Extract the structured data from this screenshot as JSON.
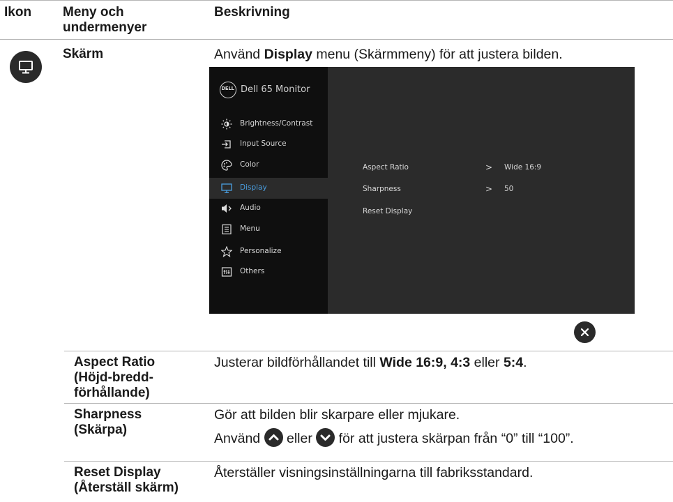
{
  "headers": {
    "icon": "Ikon",
    "menu": "Meny och undermenyer",
    "description": "Beskrivning"
  },
  "display_row": {
    "menu_name": "Skärm",
    "intro_prefix": "Använd ",
    "intro_bold": "Display",
    "intro_suffix": " menu (Skärmmeny) för att justera bilden."
  },
  "osd": {
    "logo_text": "DELL",
    "title": "Dell 65 Monitor",
    "menu": [
      {
        "label": "Brightness/Contrast",
        "icon": "sun-icon"
      },
      {
        "label": "Input Source",
        "icon": "input-source-icon"
      },
      {
        "label": "Color",
        "icon": "palette-icon"
      },
      {
        "label": "Display",
        "icon": "monitor-icon",
        "selected": true
      },
      {
        "label": "Audio",
        "icon": "speaker-icon"
      },
      {
        "label": "Menu",
        "icon": "menu-list-icon"
      },
      {
        "label": "Personalize",
        "icon": "star-icon"
      },
      {
        "label": "Others",
        "icon": "others-icon"
      }
    ],
    "settings": [
      {
        "label": "Aspect Ratio",
        "value": "Wide 16:9"
      },
      {
        "label": "Sharpness",
        "value": "50"
      },
      {
        "label": "Reset Display",
        "value": ""
      }
    ],
    "arrow": ">"
  },
  "rows": [
    {
      "term_lines": [
        "Aspect Ratio",
        "(Höjd-bredd-",
        "förhållande)"
      ],
      "desc_prefix": "Justerar bildförhållandet till ",
      "desc_bold1": "Wide 16:9, 4:3",
      "desc_mid": " eller ",
      "desc_bold2": "5:4",
      "desc_suffix": "."
    },
    {
      "term_lines": [
        "Sharpness",
        "(Skärpa)"
      ],
      "line1": "Gör att bilden blir skarpare eller mjukare.",
      "line2_prefix": "Använd ",
      "line2_mid": " eller ",
      "line2_suffix": " för att justera skärpan från “0” till “100”."
    },
    {
      "term_lines": [
        "Reset Display",
        "(Återställ skärm)"
      ],
      "desc": "Återställer visningsinställningarna till fabriksstandard."
    }
  ]
}
